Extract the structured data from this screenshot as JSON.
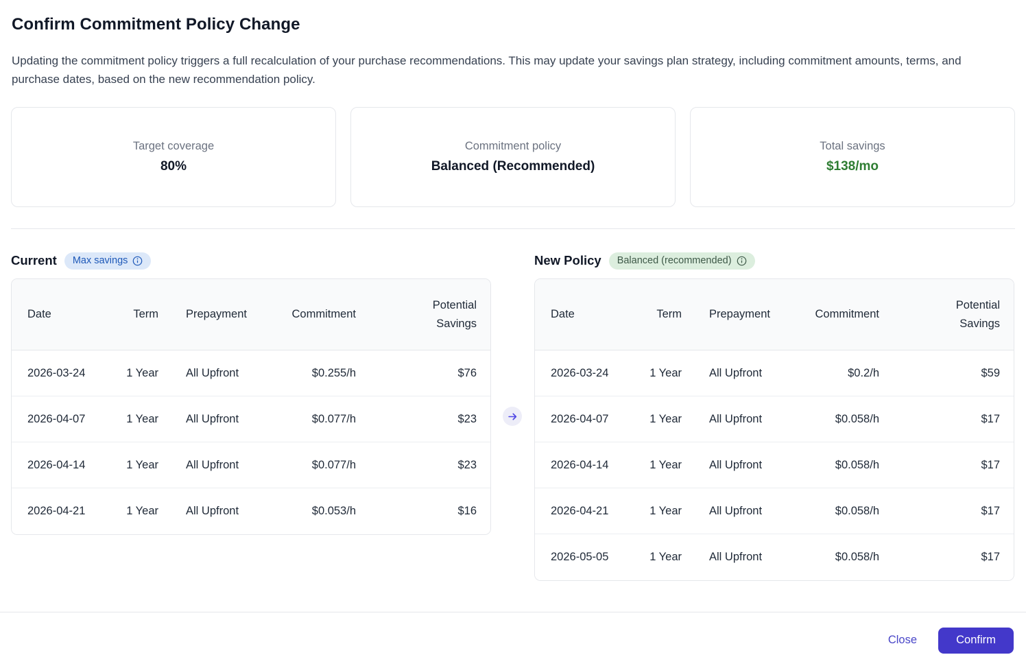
{
  "dialog": {
    "title": "Confirm Commitment Policy Change",
    "description": "Updating the commitment policy triggers a full recalculation of your purchase recommendations. This may update your savings plan strategy, including commitment amounts, terms, and purchase dates, based on the new recommendation policy."
  },
  "summary_cards": [
    {
      "label": "Target coverage",
      "value": "80%"
    },
    {
      "label": "Commitment policy",
      "value": "Balanced (Recommended)"
    },
    {
      "label": "Total savings",
      "value": "$138/mo",
      "value_color": "#2e7d32"
    }
  ],
  "current_policy": {
    "heading": "Current",
    "badge_label": "Max savings",
    "badge_icon": "info-circle-icon",
    "table": {
      "headers": [
        "Date",
        "Term",
        "Prepayment",
        "Commitment",
        "Potential Savings"
      ],
      "rows": [
        [
          "2026-03-24",
          "1 Year",
          "All Upfront",
          "$0.255/h",
          "$76"
        ],
        [
          "2026-04-07",
          "1 Year",
          "All Upfront",
          "$0.077/h",
          "$23"
        ],
        [
          "2026-04-14",
          "1 Year",
          "All Upfront",
          "$0.077/h",
          "$23"
        ],
        [
          "2026-04-21",
          "1 Year",
          "All Upfront",
          "$0.053/h",
          "$16"
        ]
      ]
    }
  },
  "new_policy": {
    "heading": "New Policy",
    "badge_label": "Balanced (recommended)",
    "badge_icon": "info-circle-icon",
    "table": {
      "headers": [
        "Date",
        "Term",
        "Prepayment",
        "Commitment",
        "Potential Savings"
      ],
      "rows": [
        [
          "2026-03-24",
          "1 Year",
          "All Upfront",
          "$0.2/h",
          "$59"
        ],
        [
          "2026-04-07",
          "1 Year",
          "All Upfront",
          "$0.058/h",
          "$17"
        ],
        [
          "2026-04-14",
          "1 Year",
          "All Upfront",
          "$0.058/h",
          "$17"
        ],
        [
          "2026-04-21",
          "1 Year",
          "All Upfront",
          "$0.058/h",
          "$17"
        ],
        [
          "2026-05-05",
          "1 Year",
          "All Upfront",
          "$0.058/h",
          "$17"
        ]
      ]
    }
  },
  "transition_icon": "arrow-right-icon",
  "footer": {
    "close_label": "Close",
    "confirm_label": "Confirm"
  },
  "colors": {
    "accent_indigo": "#4338ca",
    "savings_green": "#2e7d32",
    "badge_blue_bg": "#dce8f9",
    "badge_blue_text": "#1d58b8",
    "badge_green_bg": "#dceede",
    "badge_green_text": "#3e5948",
    "border_gray": "#e5e7eb",
    "header_row_bg": "#f9fafb"
  }
}
